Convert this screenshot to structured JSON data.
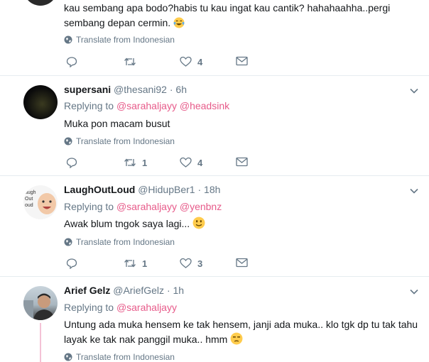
{
  "tweets": [
    {
      "text": "kau sembang apa bodo?habis tu kau ingat kau cantik? hahahaahha..pergi sembang depan cermin.",
      "translate": "Translate from Indonesian",
      "replies": "",
      "retweets": "",
      "likes": "4"
    },
    {
      "name": "supersani",
      "handle": "@thesani92",
      "sep": "·",
      "time": "6h",
      "replying_label": "Replying to",
      "reply_to": [
        "@sarahaljayy",
        "@headsink"
      ],
      "text": "Muka pon macam busut",
      "translate": "Translate from Indonesian",
      "replies": "",
      "retweets": "1",
      "likes": "4"
    },
    {
      "name": "LaughOutLoud",
      "handle": "@HidupBer1",
      "sep": "·",
      "time": "18h",
      "avatar_text": [
        "augh",
        "Out",
        "oud"
      ],
      "replying_label": "Replying to",
      "reply_to": [
        "@sarahaljayy",
        "@yenbnz"
      ],
      "text": "Awak blum tngok saya lagi...",
      "translate": "Translate from Indonesian",
      "replies": "",
      "retweets": "1",
      "likes": "3"
    },
    {
      "name": "Arief Gelz",
      "handle": "@AriefGelz",
      "sep": "·",
      "time": "1h",
      "replying_label": "Replying to",
      "reply_to": [
        "@sarahaljayy"
      ],
      "text": "Untung ada muka hensem ke tak hensem, janji ada muka.. klo tgk dp tu tak tahu layak ke tak nak panggil muka.. hmm",
      "translate": "Translate from Indonesian"
    }
  ],
  "colors": {
    "link": "#e75b8a",
    "muted": "#657786",
    "divider": "#e6ecf0"
  }
}
